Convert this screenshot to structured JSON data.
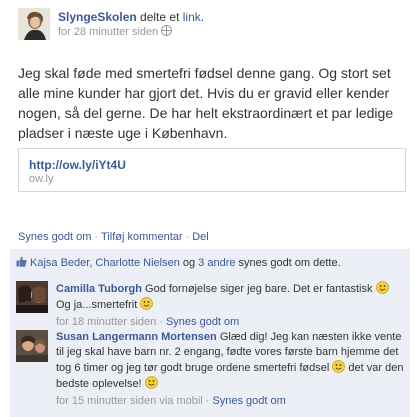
{
  "post": {
    "author": "SlyngeSkolen",
    "shared_text": " delte et ",
    "shared_link": "link",
    "shared_period": ".",
    "timestamp": "for 28 minutter siden",
    "body": "Jeg skal føde med smertefri fødsel denne gang. Og stort set alle mine kunder har gjort det. Hvis du er gravid eller kender nogen, så del gerne. De har helt ekstraordinært et par ledige pladser i næste uge i København.",
    "link_url": "http://ow.ly/iYt4U",
    "link_domain": "ow.ly"
  },
  "actions": {
    "like": "Synes godt om",
    "comment": "Tilføj kommentar",
    "share": "Del"
  },
  "likes": {
    "names": "Kajsa Beder, Charlotte Nielsen",
    "and": " og ",
    "others": "3 andre",
    "suffix": " synes godt om dette."
  },
  "comments": [
    {
      "author": "Camilla Tuborgh",
      "text_a": "God fornøjelse siger jeg bare. Det er fantastisk ",
      "text_b": " Og ja...smertefrit ",
      "time": "for 18 minutter siden",
      "like": "Synes godt om"
    },
    {
      "author": "Susan Langermann Mortensen",
      "text_a": "Glæd dig! Jeg kan næsten ikke vente til jeg skal have barn nr. 2 engang, fødte vores første barn hjemme det tog 6 timer og jeg tør godt bruge ordene smertefri fødsel ",
      "text_b": " det var den bedste oplevelse! ",
      "time": "for 15 minutter siden via mobil",
      "like": "Synes godt om"
    }
  ],
  "icons": {
    "globe": "globe-icon",
    "thumb": "thumbs-up-icon",
    "smiley": "smiley-icon"
  },
  "colors": {
    "link": "#3b5998",
    "feedback_bg": "#eceff5",
    "muted": "#999999"
  }
}
